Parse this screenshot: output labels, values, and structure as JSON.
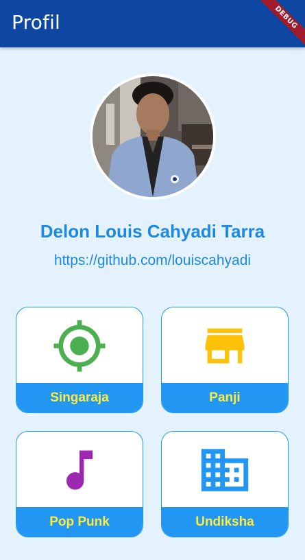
{
  "appbar": {
    "title": "Profil",
    "debug_label": "DEBUG"
  },
  "profile": {
    "name": "Delon Louis Cahyadi Tarra",
    "link": "https://github.com/louiscahyadi"
  },
  "cards": [
    {
      "label": "Singaraja",
      "icon": "location-icon",
      "icon_color": "#4CAF50"
    },
    {
      "label": "Panji",
      "icon": "store-icon",
      "icon_color": "#FFC107"
    },
    {
      "label": "Pop Punk",
      "icon": "music-note-icon",
      "icon_color": "#9C27B0"
    },
    {
      "label": "Undiksha",
      "icon": "building-icon",
      "icon_color": "#2196F3"
    }
  ],
  "colors": {
    "appbar": "#0D47A1",
    "background": "#E3F2FD",
    "accent": "#2196F3",
    "label_text": "#FFEB3B",
    "name_text": "#1E88E5"
  }
}
